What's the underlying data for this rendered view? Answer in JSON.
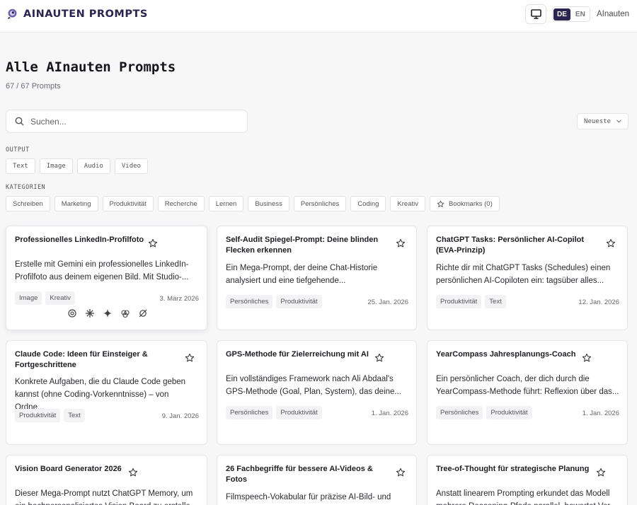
{
  "header": {
    "brand": "AINAUTEN PROMPTS",
    "lang_de": "DE",
    "lang_en": "EN",
    "user": "AInauten"
  },
  "page": {
    "title": "Alle AInauten Prompts",
    "count": "67 / 67 Prompts"
  },
  "search": {
    "placeholder": "Suchen..."
  },
  "sort": {
    "label": "Neueste"
  },
  "filters": {
    "output_label": "OUTPUT",
    "output": [
      "Text",
      "Image",
      "Audio",
      "Video"
    ],
    "categories_label": "KATEGORIEN",
    "categories": [
      "Schreiben",
      "Marketing",
      "Produktivität",
      "Recherche",
      "Lernen",
      "Business",
      "Persönliches",
      "Coding",
      "Kreativ"
    ],
    "bookmarks": "Bookmarks (0)"
  },
  "cards": [
    {
      "title": "Professionelles LinkedIn-Profilfoto",
      "desc": "Erstelle mit Gemini ein professionelles LinkedIn-Profilfoto aus deinem eigenen Bild. Mit Studio-...",
      "tags": [
        "Image",
        "Kreativ"
      ],
      "date": "3. März 2026"
    },
    {
      "title": "Self-Audit Spiegel-Prompt: Deine blinden Flecken erkennen",
      "desc": "Ein Mega-Prompt, der deine Chat-Historie analysiert und eine tiefgehende...",
      "tags": [
        "Persönliches",
        "Produktivität"
      ],
      "date": "25. Jan. 2026"
    },
    {
      "title": "ChatGPT Tasks: Persönlicher AI-Copilot (EVA-Prinzip)",
      "desc": "Richte dir mit ChatGPT Tasks (Schedules) einen persönlichen AI-Copiloten ein: tagsüber alles...",
      "tags": [
        "Produktivität",
        "Text"
      ],
      "date": "12. Jan. 2026"
    },
    {
      "title": "Claude Code: Ideen für Einsteiger & Fortgeschrittene",
      "desc": "Konkrete Aufgaben, die du Claude Code geben kannst (ohne Coding-Vorkenntnisse) – von Ordne...",
      "tags": [
        "Produktivität",
        "Text"
      ],
      "date": "9. Jan. 2026"
    },
    {
      "title": "GPS-Methode für Zielerreichung mit AI",
      "desc": "Ein vollständiges Framework nach Ali Abdaal's GPS-Methode (Goal, Plan, System), das deine...",
      "tags": [
        "Persönliches",
        "Produktivität"
      ],
      "date": "1. Jan. 2026"
    },
    {
      "title": "YearCompass Jahresplanungs-Coach",
      "desc": "Ein persönlicher Coach, der dich durch die YearCompass-Methode führt: Reflexion über das...",
      "tags": [
        "Persönliches",
        "Produktivität"
      ],
      "date": "1. Jan. 2026"
    },
    {
      "title": "Vision Board Generator 2026",
      "desc": "Dieser Mega-Prompt nutzt ChatGPT Memory, um ein hochpersonalisiertes Vision Board zu erstelle...",
      "tags": [],
      "date": ""
    },
    {
      "title": "26 Fachbegriffe für bessere AI-Videos & Fotos",
      "desc": "Filmspeech-Vokabular für präzise AI-Bild- und Video-Prompts...",
      "tags": [],
      "date": ""
    },
    {
      "title": "Tree-of-Thought für strategische Planung",
      "desc": "Anstatt linearem Prompting erkundet das Modell mehrere Reasoning-Pfade parallel, bewertet Vor...",
      "tags": [],
      "date": ""
    }
  ],
  "colors": {
    "brand": "#2b2452",
    "background": "#f7f7f8",
    "card": "#ffffff"
  }
}
